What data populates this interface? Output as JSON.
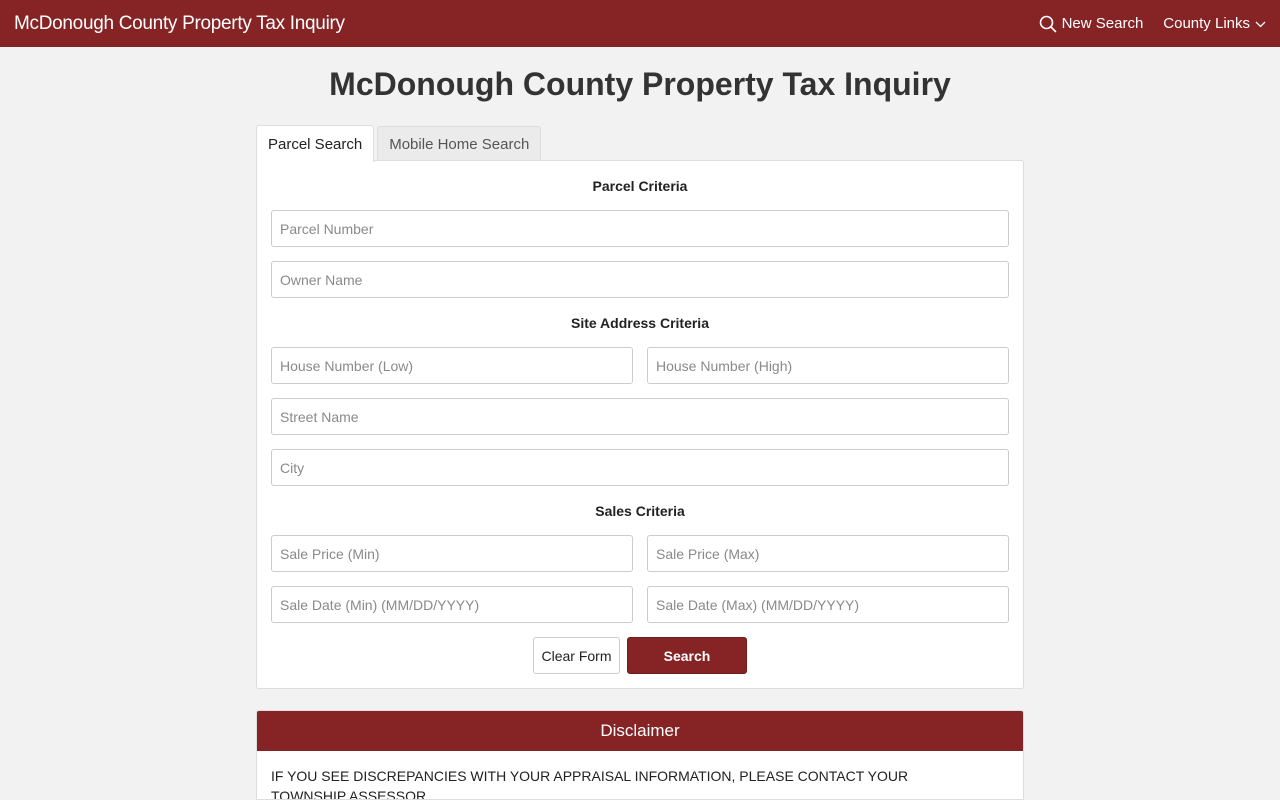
{
  "navbar": {
    "brand": "McDonough County Property Tax Inquiry",
    "new_search_label": "New Search",
    "county_links_label": "County Links",
    "color": "#862325"
  },
  "page": {
    "title": "McDonough County Property Tax Inquiry"
  },
  "tabs": [
    {
      "label": "Parcel Search",
      "active": true
    },
    {
      "label": "Mobile Home Search",
      "active": false
    }
  ],
  "form": {
    "parcel_criteria_title": "Parcel Criteria",
    "parcel_number_placeholder": "Parcel Number",
    "owner_name_placeholder": "Owner Name",
    "site_address_title": "Site Address Criteria",
    "house_low_placeholder": "House Number (Low)",
    "house_high_placeholder": "House Number (High)",
    "street_name_placeholder": "Street Name",
    "city_placeholder": "City",
    "sales_title": "Sales Criteria",
    "sale_price_min_placeholder": "Sale Price (Min)",
    "sale_price_max_placeholder": "Sale Price (Max)",
    "sale_date_min_placeholder": "Sale Date (Min) (MM/DD/YYYY)",
    "sale_date_max_placeholder": "Sale Date (Max) (MM/DD/YYYY)",
    "clear_label": "Clear Form",
    "search_label": "Search"
  },
  "disclaimer": {
    "title": "Disclaimer",
    "text": "IF YOU SEE DISCREPANCIES WITH YOUR APPRAISAL INFORMATION, PLEASE CONTACT YOUR TOWNSHIP ASSESSOR."
  },
  "icons": {
    "search": "search-icon",
    "chevron": "chevron-down-icon"
  }
}
